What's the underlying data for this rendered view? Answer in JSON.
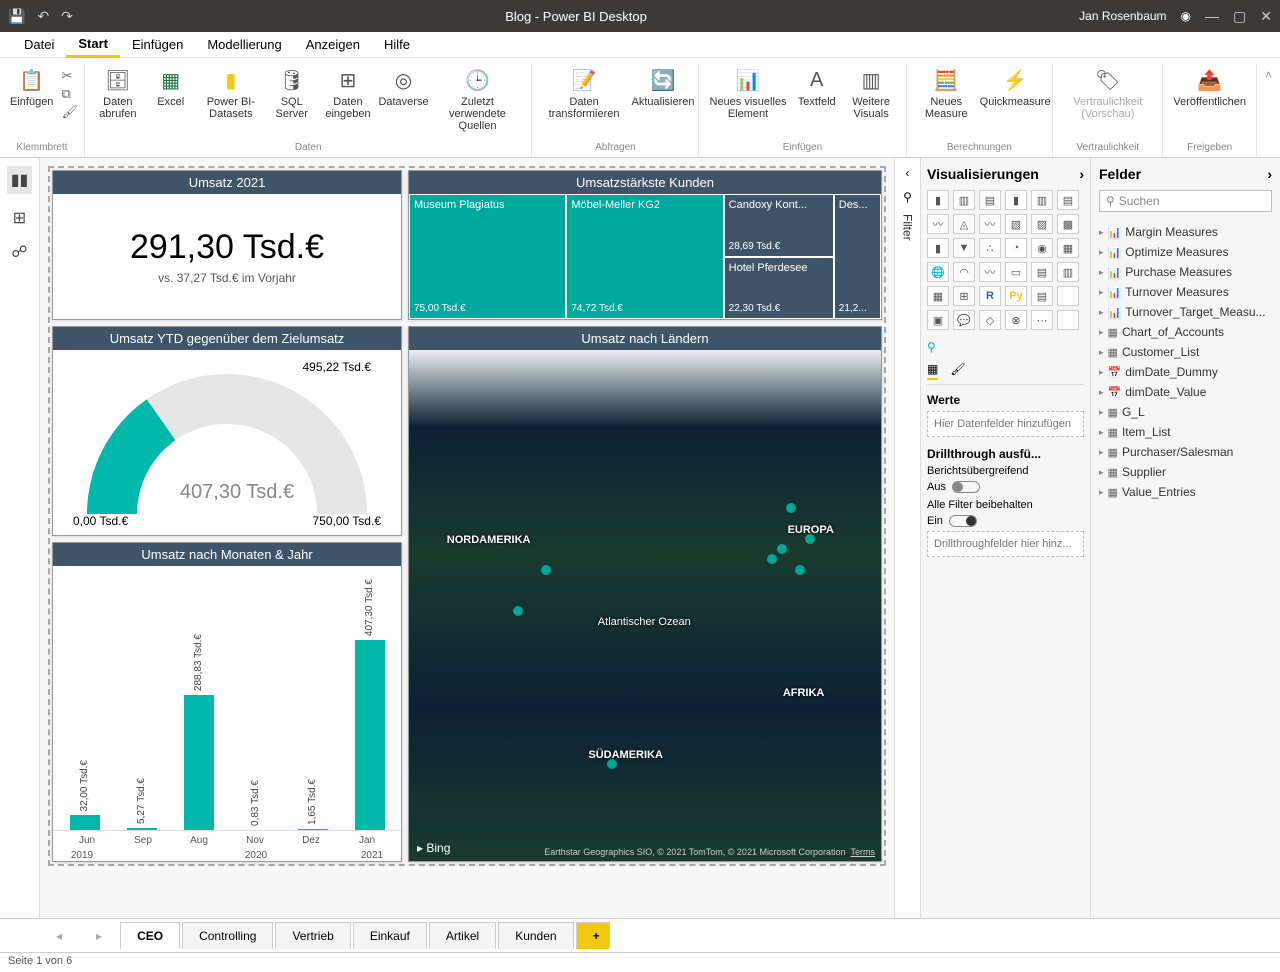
{
  "titlebar": {
    "title": "Blog - Power BI Desktop",
    "user": "Jan Rosenbaum"
  },
  "menu": {
    "tabs": [
      "Datei",
      "Start",
      "Einfügen",
      "Modellierung",
      "Anzeigen",
      "Hilfe"
    ],
    "active": 1
  },
  "ribbon": {
    "groups": [
      {
        "label": "Klemmbrett",
        "items": [
          {
            "label": "Einfügen"
          }
        ]
      },
      {
        "label": "Daten",
        "items": [
          {
            "label": "Daten abrufen"
          },
          {
            "label": "Excel"
          },
          {
            "label": "Power BI-Datasets"
          },
          {
            "label": "SQL Server"
          },
          {
            "label": "Daten eingeben"
          },
          {
            "label": "Dataverse"
          },
          {
            "label": "Zuletzt verwendete Quellen"
          }
        ]
      },
      {
        "label": "Abfragen",
        "items": [
          {
            "label": "Daten transformieren"
          },
          {
            "label": "Aktualisieren"
          }
        ]
      },
      {
        "label": "Einfügen",
        "items": [
          {
            "label": "Neues visuelles Element"
          },
          {
            "label": "Textfeld"
          },
          {
            "label": "Weitere Visuals"
          }
        ]
      },
      {
        "label": "Berechnungen",
        "items": [
          {
            "label": "Neues Measure"
          },
          {
            "label": "Quickmeasure"
          }
        ]
      },
      {
        "label": "Vertraulichkeit",
        "items": [
          {
            "label": "Vertraulichkeit (Vorschau)",
            "disabled": true
          }
        ]
      },
      {
        "label": "Freigeben",
        "items": [
          {
            "label": "Veröffentlichen"
          }
        ]
      }
    ]
  },
  "kpi": {
    "title": "Umsatz 2021",
    "value": "291,30 Tsd.€",
    "sub": "vs. 37,27 Tsd.€ im Vorjahr"
  },
  "gauge": {
    "title": "Umsatz YTD gegenüber dem Zielumsatz",
    "target": "495,22 Tsd.€",
    "value": "407,30 Tsd.€",
    "min": "0,00 Tsd.€",
    "max": "750,00 Tsd.€"
  },
  "chart_data": {
    "type": "bar",
    "title": "Umsatz nach Monaten & Jahr",
    "categories": [
      "Jun",
      "Sep",
      "Aug",
      "Nov",
      "Dez",
      "Jan"
    ],
    "years": [
      "2019",
      "",
      "",
      "2020",
      "",
      "2021"
    ],
    "values": [
      32.0,
      5.27,
      288.83,
      0.83,
      1.65,
      407.3
    ],
    "value_labels": [
      "32,00 Tsd.€",
      "5,27 Tsd.€",
      "288,83 Tsd.€",
      "0,83 Tsd.€",
      "1,65 Tsd.€",
      "407,30 Tsd.€"
    ],
    "ylabel": "Tsd.€",
    "ylim": [
      0,
      420
    ]
  },
  "treemap": {
    "title": "Umsatzstärkste Kunden",
    "cells": [
      {
        "name": "Museum Plagiatus",
        "value": "75,00 Tsd.€",
        "class": "big"
      },
      {
        "name": "Möbel-Meller KG2",
        "value": "74,72 Tsd.€",
        "class": "big"
      },
      {
        "name": "Candoxy Kont...",
        "value": "28,69 Tsd.€",
        "class": "med"
      },
      {
        "name": "Hotel Pferdesee",
        "value": "22,30 Tsd.€",
        "class": "med"
      },
      {
        "name": "Des...",
        "value": "21,2...",
        "class": "med"
      }
    ]
  },
  "map": {
    "title": "Umsatz nach Ländern",
    "labels": [
      "NORDAMERIKA",
      "EUROPA",
      "Atlantischer Ozean",
      "AFRIKA",
      "SÜDAMERIKA"
    ],
    "attribution": "Earthstar Geographics SIO, © 2021 TomTom, © 2021 Microsoft Corporation",
    "terms": "Terms",
    "provider": "Bing"
  },
  "filter": {
    "label": "Filter"
  },
  "viz": {
    "title": "Visualisierungen",
    "werte": "Werte",
    "drop": "Hier Datenfelder hinzufügen",
    "drill": "Drillthrough ausfü...",
    "cross": "Berichtsübergreifend",
    "aus": "Aus",
    "keepall": "Alle Filter beibehalten",
    "ein": "Ein",
    "drillfields": "Drillthroughfelder hier hinz..."
  },
  "fields": {
    "title": "Felder",
    "search": "Suchen",
    "items": [
      {
        "icon": "📊",
        "label": "Margin Measures"
      },
      {
        "icon": "📊",
        "label": "Optimize Measures"
      },
      {
        "icon": "📊",
        "label": "Purchase Measures"
      },
      {
        "icon": "📊",
        "label": "Turnover Measures"
      },
      {
        "icon": "📊",
        "label": "Turnover_Target_Measu..."
      },
      {
        "icon": "▦",
        "label": "Chart_of_Accounts"
      },
      {
        "icon": "▦",
        "label": "Customer_List"
      },
      {
        "icon": "📅",
        "label": "dimDate_Dummy"
      },
      {
        "icon": "📅",
        "label": "dimDate_Value"
      },
      {
        "icon": "▦",
        "label": "G_L"
      },
      {
        "icon": "▦",
        "label": "Item_List"
      },
      {
        "icon": "▦",
        "label": "Purchaser/Salesman"
      },
      {
        "icon": "▦",
        "label": "Supplier"
      },
      {
        "icon": "▦",
        "label": "Value_Entries"
      }
    ]
  },
  "pages": {
    "tabs": [
      "CEO",
      "Controlling",
      "Vertrieb",
      "Einkauf",
      "Artikel",
      "Kunden"
    ],
    "active": 0,
    "status": "Seite 1 von 6",
    "add": "+"
  }
}
